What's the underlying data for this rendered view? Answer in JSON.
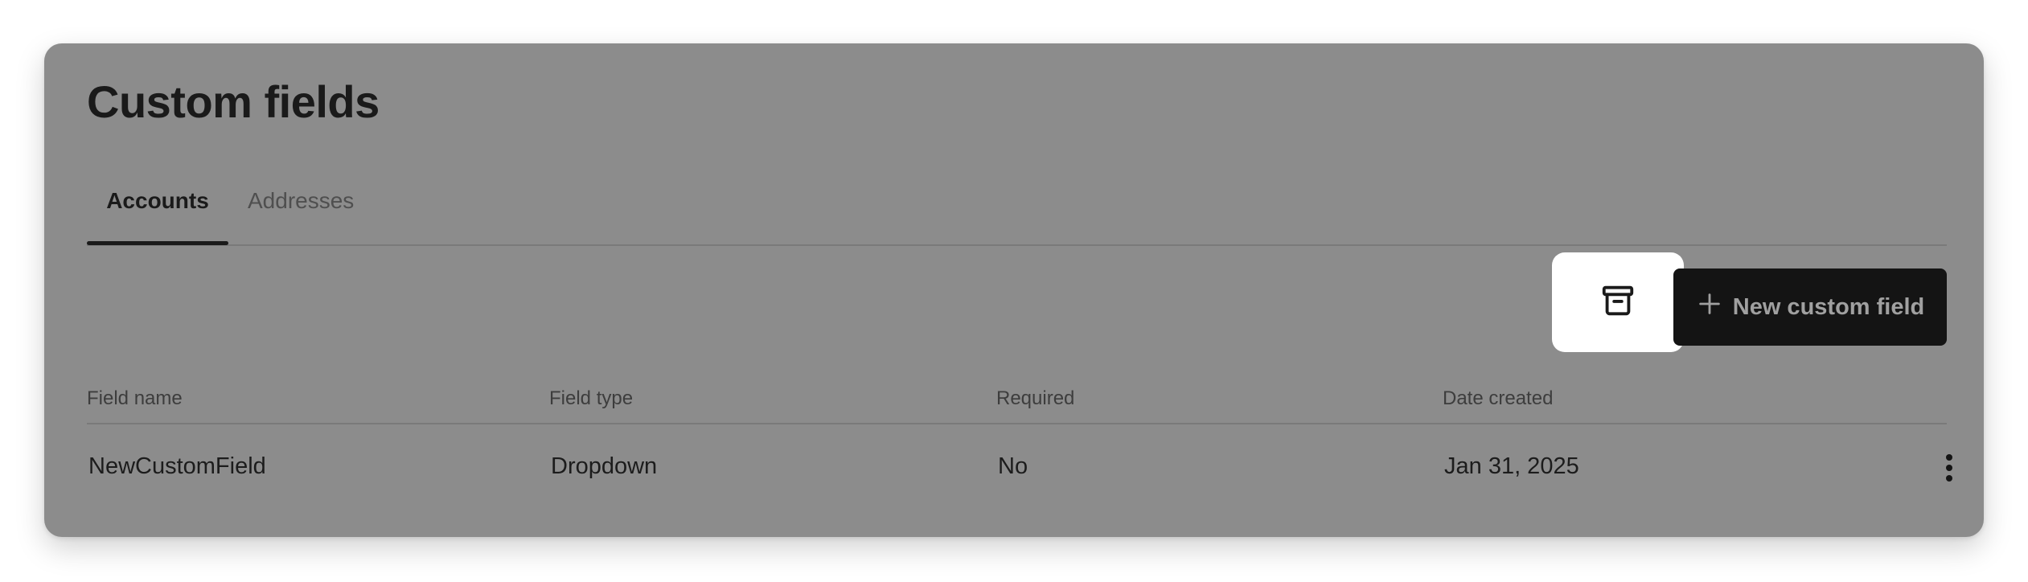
{
  "page": {
    "title": "Custom fields"
  },
  "tabs": [
    {
      "label": "Accounts",
      "active": true
    },
    {
      "label": "Addresses",
      "active": false
    }
  ],
  "toolbar": {
    "archive_icon": "archive-box-icon",
    "new_button_icon": "plus-icon",
    "new_button_label": "New custom field"
  },
  "table": {
    "columns": [
      "Field name",
      "Field type",
      "Required",
      "Date created"
    ],
    "rows": [
      {
        "name": "NewCustomField",
        "type": "Dropdown",
        "required": "No",
        "date_created": "Jan 31, 2025",
        "actions_icon": "more-vertical-icon"
      }
    ]
  },
  "colors": {
    "overlay": "#8c8c8c",
    "primary_button": "#141414",
    "text": "#1a1a1a"
  }
}
